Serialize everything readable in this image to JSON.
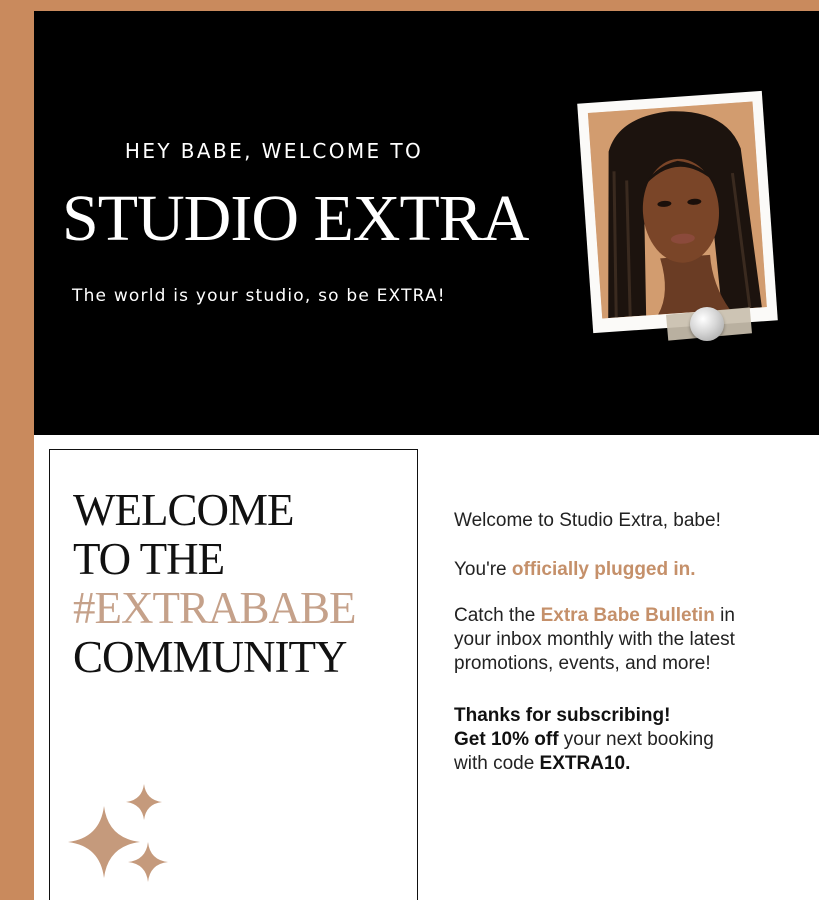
{
  "hero": {
    "eyebrow": "HEY BABE, WELCOME TO",
    "brand": "STUDIO EXTRA",
    "tagline": "The world is your studio, so be EXTRA!"
  },
  "panel": {
    "line_1": "WELCOME",
    "line_2": "TO THE",
    "line_3": "#EXTRABABE",
    "line_4": "COMMUNITY"
  },
  "copy": {
    "welcome": "Welcome to Studio Extra, babe!",
    "plugged_prefix": "You're ",
    "plugged_highlight": "officially plugged in.",
    "bulletin_prefix": "Catch the ",
    "bulletin_highlight": "Extra Babe Bulletin",
    "bulletin_suffix": " in",
    "bulletin_line_2": "your inbox monthly with the latest",
    "bulletin_line_3": "promotions, events, and more!",
    "thanks": "Thanks for subscribing!",
    "offer_bold": "Get 10% off",
    "offer_rest": " your next booking",
    "code_prefix": "with code ",
    "code": "EXTRA10."
  },
  "colors": {
    "background": "#c98a5d",
    "hero": "#000000",
    "accent": "#c5a18a",
    "highlight": "#c5906a"
  },
  "icons": {
    "sparkle": "sparkle-icon",
    "pin": "pushpin-icon"
  }
}
